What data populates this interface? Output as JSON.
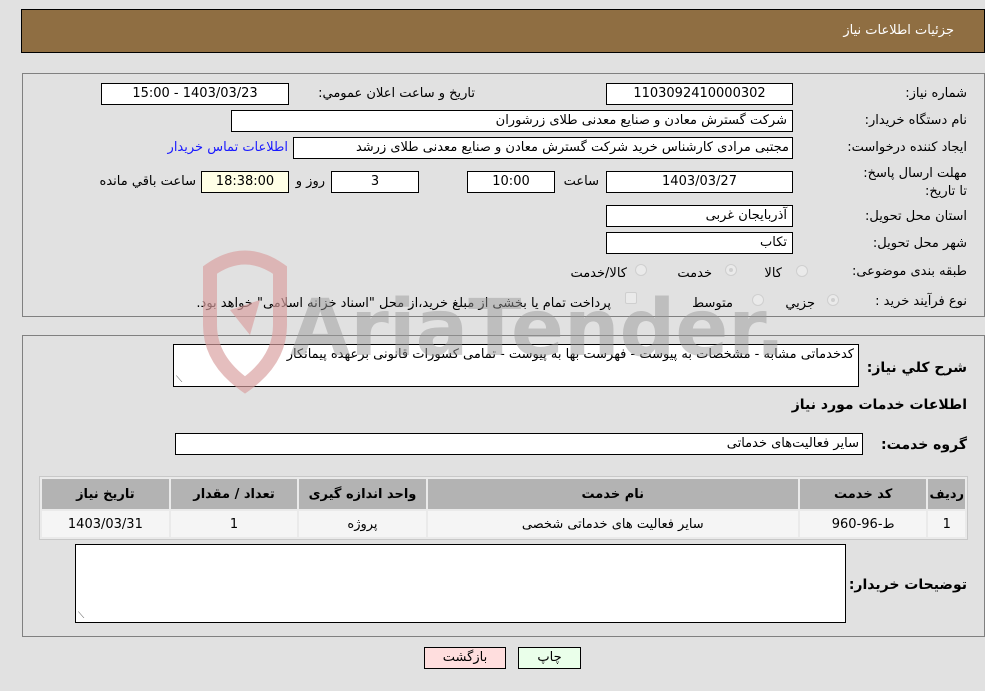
{
  "header": {
    "title": "جزئیات اطلاعات نیاز"
  },
  "form": {
    "need_number": {
      "label": "شماره نیاز:",
      "value": "1103092410000302"
    },
    "announce_datetime": {
      "label": "تاریخ و ساعت اعلان عمومي:",
      "value": "1403/03/23 - 15:00"
    },
    "buyer_org": {
      "label": "نام دستگاه خريدار:",
      "value": "شرکت گسترش معادن و صنایع معدنی طلای زرشوران"
    },
    "requester": {
      "label": "ایجاد کننده درخواست:",
      "value": "مجتبی مرادی کارشناس خرید شرکت گسترش معادن و صنایع معدنی طلای زرشد",
      "contact_link": "اطلاعات تماس خریدار"
    },
    "deadline": {
      "label": "مهلت ارسال پاسخ: تا تاریخ:",
      "date": "1403/03/27",
      "time_label": "ساعت",
      "time": "10:00",
      "days": "3",
      "days_label": "روز و",
      "remaining": "18:38:00",
      "remaining_label": "ساعت باقي مانده"
    },
    "province": {
      "label": "استان محل تحویل:",
      "value": "آذربایجان غربی"
    },
    "city": {
      "label": "شهر محل تحویل:",
      "value": "تکاب"
    },
    "category": {
      "label": "طبقه بندی موضوعی:",
      "options": [
        "کالا",
        "خدمت",
        "کالا/خدمت"
      ],
      "selected": "خدمت"
    },
    "process_type": {
      "label": "نوع فرآیند خرید :",
      "options": [
        "جزيي",
        "متوسط"
      ],
      "selected": "جزيي",
      "treasury_note": "پرداخت تمام یا بخشی از مبلغ خرید،از محل \"اسناد خزانه اسلامی\" خواهد بود."
    }
  },
  "description": {
    "label": "شرح كلي نياز:",
    "value": "کدخدماتی مشابه - مشخصات به پیوست - فهرست بها به پیوست - تمامی کسورات قانونی برعهده پیمانکار"
  },
  "services_section": {
    "title": "اطلاعات خدمات مورد نياز",
    "group_label": "گروه خدمت:",
    "group_value": "سایر فعالیت‌های خدماتی",
    "table": {
      "headers": [
        "ردیف",
        "کد خدمت",
        "نام خدمت",
        "واحد اندازه گیری",
        "تعداد / مقدار",
        "تاریخ نیاز"
      ],
      "rows": [
        [
          "1",
          "ط-96-960",
          "سایر فعالیت های خدماتی شخصی",
          "پروژه",
          "1",
          "1403/03/31"
        ]
      ]
    }
  },
  "buyer_notes": {
    "label": "توضیحات خریدار:",
    "value": ""
  },
  "buttons": {
    "print": "چاپ",
    "back": "بازگشت"
  },
  "watermark": {
    "text": "AriaTender.neT"
  }
}
